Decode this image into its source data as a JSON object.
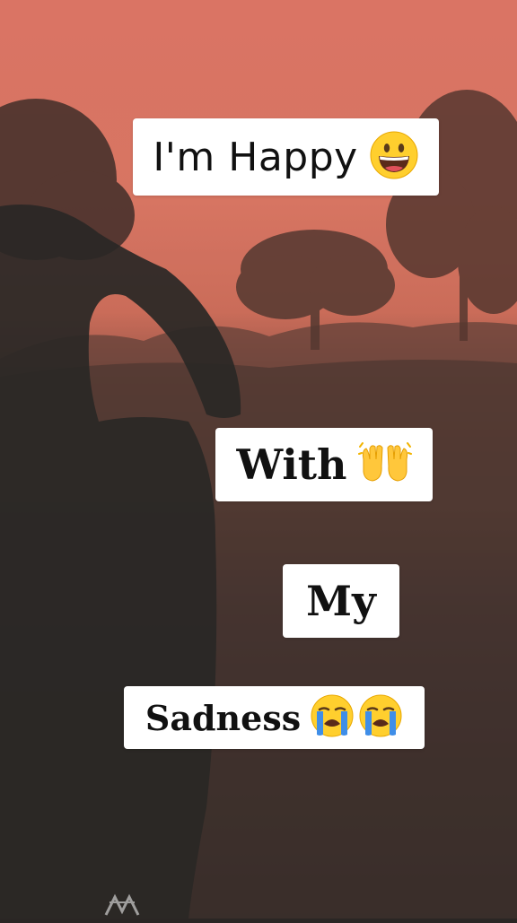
{
  "captions": [
    {
      "text": "I'm Happy",
      "emoji": "grinning-face-icon"
    },
    {
      "text": "With",
      "emoji": "raising-hands-icon"
    },
    {
      "text": "My"
    },
    {
      "text": "Sadness",
      "emoji": "loudly-crying-face-icon"
    }
  ],
  "colors": {
    "sky": "#e87c6b",
    "ground_dark": "#2c2826",
    "caption_bg": "#ffffff",
    "caption_text": "#111111"
  }
}
